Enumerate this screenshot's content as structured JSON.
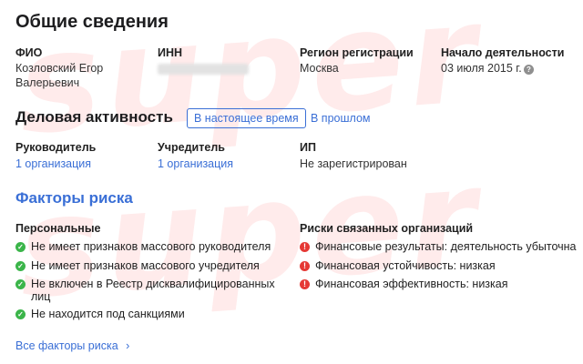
{
  "watermark": "super",
  "general": {
    "title": "Общие сведения",
    "fio_label": "ФИО",
    "fio_value_line1": "Козловский Егор",
    "fio_value_line2": "Валерьевич",
    "inn_label": "ИНН",
    "region_label": "Регион регистрации",
    "region_value": "Москва",
    "start_label": "Начало деятельности",
    "start_value": "03 июля 2015 г.",
    "help_icon_glyph": "?"
  },
  "activity": {
    "title": "Деловая активность",
    "tab_current": "В настоящее время",
    "tab_past": "В прошлом",
    "manager_label": "Руководитель",
    "manager_value": "1 организация",
    "founder_label": "Учредитель",
    "founder_value": "1 организация",
    "ip_label": "ИП",
    "ip_value": "Не зарегистрирован"
  },
  "risks": {
    "title": "Факторы риска",
    "personal_title": "Персональные",
    "personal_items": [
      "Не имеет признаков массового руководителя",
      "Не имеет признаков массового учредителя",
      "Не включен в Реестр дисквалифицированных",
      "лиц",
      "Не находится под санкциями"
    ],
    "related_title": "Риски связанных организаций",
    "related_items": [
      "Финансовые результаты: деятельность убыточна",
      "Финансовая устойчивость: низкая",
      "Финансовая эффективность: низкая"
    ],
    "all_link": "Все факторы риска",
    "all_link_arrow": "›"
  },
  "colors": {
    "accent": "#3a6fd6",
    "ok": "#3bb54a",
    "bad": "#e53935"
  },
  "icons": {
    "ok": "check-circle-icon",
    "bad": "exclamation-circle-icon",
    "help": "question-circle-icon"
  }
}
